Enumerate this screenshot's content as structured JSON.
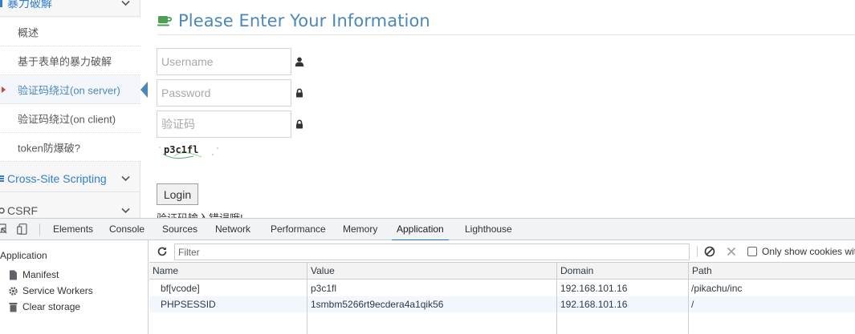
{
  "sidebar": {
    "groups": [
      {
        "label": "暴力破解"
      },
      {
        "label": "Cross-Site Scripting"
      },
      {
        "label": "CSRF"
      }
    ],
    "sub_items": [
      {
        "label": "概述"
      },
      {
        "label": "基于表单的暴力破解"
      },
      {
        "label": "验证码绕过(on server)"
      },
      {
        "label": "验证码绕过(on client)"
      },
      {
        "label": "token防爆破?"
      }
    ]
  },
  "form": {
    "title": "Please Enter Your Information",
    "username_placeholder": "Username",
    "password_placeholder": "Password",
    "captcha_placeholder": "验证码",
    "captcha_text": "p3c1fl",
    "login_label": "Login",
    "error_message": "验证码输入错误哦!"
  },
  "devtools": {
    "tabs": [
      "Elements",
      "Console",
      "Sources",
      "Network",
      "Performance",
      "Memory",
      "Application",
      "Lighthouse"
    ],
    "active_tab": "Application",
    "sidebar_heading": "Application",
    "sidebar_items": [
      {
        "label": "Manifest",
        "icon": "document-icon"
      },
      {
        "label": "Service Workers",
        "icon": "gear-icon"
      },
      {
        "label": "Clear storage",
        "icon": "trash-icon"
      }
    ],
    "filter_placeholder": "Filter",
    "only_show_label": "Only show cookies wit",
    "columns": [
      "Name",
      "Value",
      "Domain",
      "Path"
    ],
    "rows": [
      {
        "name": "bf[vcode]",
        "value": "p3c1fl",
        "domain": "192.168.101.16",
        "path": "/pikachu/inc"
      },
      {
        "name": "PHPSESSID",
        "value": "1smbm5266rt9ecdera4a1qik56",
        "domain": "192.168.101.16",
        "path": "/"
      }
    ]
  },
  "colors": {
    "accent_blue": "#4b88b7",
    "nav_blue": "#307ecc",
    "coffee_green": "#4d9f53",
    "devtools_active": "#1a73e8"
  }
}
